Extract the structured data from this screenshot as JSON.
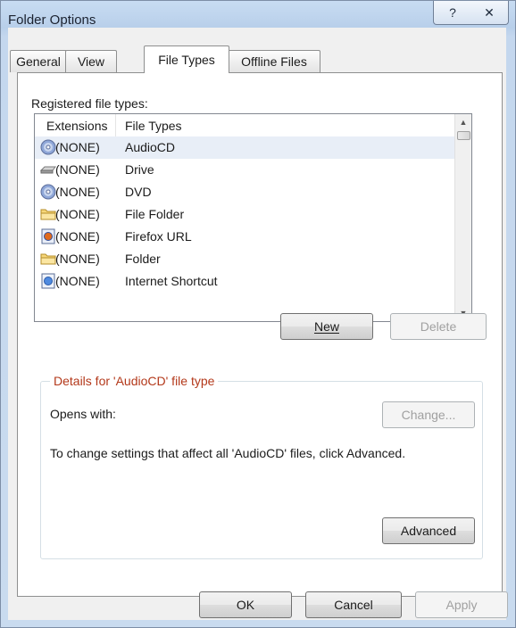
{
  "window": {
    "title": "Folder Options"
  },
  "titlebar_buttons": {
    "help": "?",
    "close": "✕"
  },
  "tabs": [
    {
      "label": "General"
    },
    {
      "label": "View"
    },
    {
      "label": "File Types"
    },
    {
      "label": "Offline Files"
    }
  ],
  "registered": {
    "label": "Registered file types:",
    "columns": [
      "Extensions",
      "File Types"
    ],
    "rows": [
      {
        "ext": "(NONE)",
        "type": "AudioCD",
        "icon": "cd-icon"
      },
      {
        "ext": "(NONE)",
        "type": "Drive",
        "icon": "drive-icon"
      },
      {
        "ext": "(NONE)",
        "type": "DVD",
        "icon": "dvd-icon"
      },
      {
        "ext": "(NONE)",
        "type": "File Folder",
        "icon": "folder-icon"
      },
      {
        "ext": "(NONE)",
        "type": "Firefox URL",
        "icon": "firefox-url-icon"
      },
      {
        "ext": "(NONE)",
        "type": "Folder",
        "icon": "folder-icon"
      },
      {
        "ext": "(NONE)",
        "type": "Internet Shortcut",
        "icon": "internet-shortcut-icon"
      }
    ]
  },
  "list_buttons": {
    "new": "New",
    "delete": "Delete"
  },
  "details": {
    "title": "Details for 'AudioCD' file type",
    "opens_with": "Opens with:",
    "change": "Change...",
    "info": "To change settings that affect all 'AudioCD' files, click Advanced.",
    "advanced": "Advanced"
  },
  "footer": {
    "ok": "OK",
    "cancel": "Cancel",
    "apply": "Apply"
  },
  "colors": {
    "details_title": "#b3381a",
    "selected_row": "#e8eef7"
  }
}
